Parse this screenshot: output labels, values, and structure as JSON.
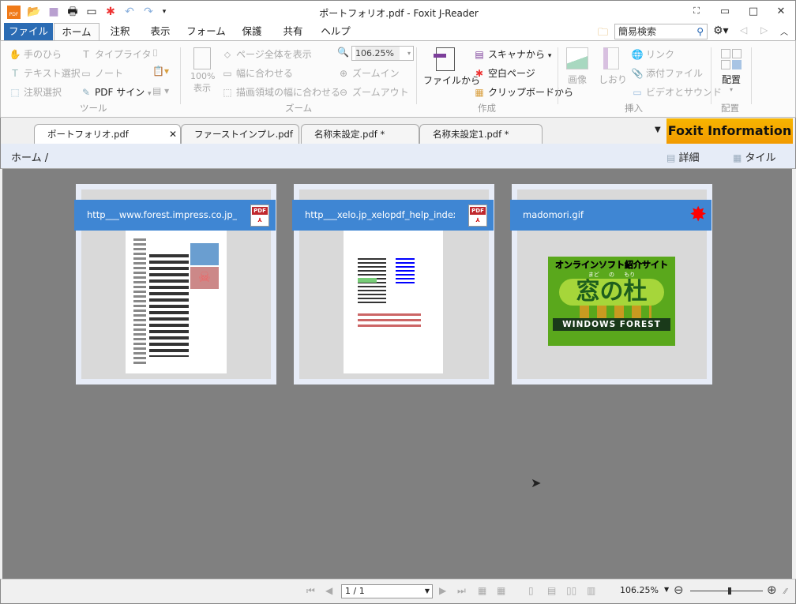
{
  "window": {
    "title": "ポートフォリオ.pdf - Foxit J-Reader",
    "controls": [
      "▭",
      "□",
      "✕"
    ]
  },
  "quick_access": [
    "open-icon",
    "save-icon",
    "print-icon",
    "properties-icon",
    "new-icon",
    "undo-icon",
    "redo-icon",
    "customize-icon"
  ],
  "menu": {
    "tabs": [
      "ファイル",
      "ホーム",
      "注釈",
      "表示",
      "フォーム",
      "保護",
      "共有",
      "ヘルプ"
    ],
    "active": "ホーム",
    "search_placeholder": "簡易検索"
  },
  "ribbon": {
    "tools": {
      "label": "ツール",
      "items": [
        "手のひら",
        "テキスト選択",
        "注釈選択",
        "タイプライタ",
        "ノート",
        "PDF サイン"
      ]
    },
    "zoom": {
      "label": "ズーム",
      "actual_size": "100%\n表示",
      "items": [
        "ページ全体を表示",
        "幅に合わせる",
        "描画領域の幅に合わせる"
      ],
      "zoom_value": "106.25%",
      "zoom_in": "ズームイン",
      "zoom_out": "ズームアウト"
    },
    "create": {
      "label": "作成",
      "from_file": "ファイルから",
      "items": [
        "スキャナから",
        "空白ページ",
        "クリップボードから"
      ]
    },
    "insert": {
      "label": "挿入",
      "image": "画像",
      "bookmark": "しおり",
      "items": [
        "リンク",
        "添付ファイル",
        "ビデオとサウンド"
      ]
    },
    "arrange": {
      "label": "配置",
      "button": "配置"
    }
  },
  "doc_tabs": [
    "ポートフォリオ.pdf",
    "ファーストインプレ.pdf *",
    "名称未設定.pdf *",
    "名称未設定1.pdf *"
  ],
  "foxit_info": "Foxit Information",
  "breadcrumb": {
    "path": "ホーム",
    "separator": "/",
    "views": [
      "詳細",
      "タイル"
    ]
  },
  "files": [
    {
      "name": "http___www.forest.impress.co.jp_lib_c",
      "type": "pdf",
      "badge": "PDF"
    },
    {
      "name": "http___xelo.jp_xelopdf_help_index.pd",
      "type": "pdf",
      "badge": "PDF"
    },
    {
      "name": "madomori.gif",
      "type": "gif",
      "banner": {
        "top": "オンラインソフト紹介サイト",
        "ruby": "まど の もり",
        "main": "窓の杜",
        "bottom": "WINDOWS FOREST"
      }
    }
  ],
  "status": {
    "page": "1 / 1",
    "zoom": "106.25%",
    "zoom_slider_percent": 55
  }
}
